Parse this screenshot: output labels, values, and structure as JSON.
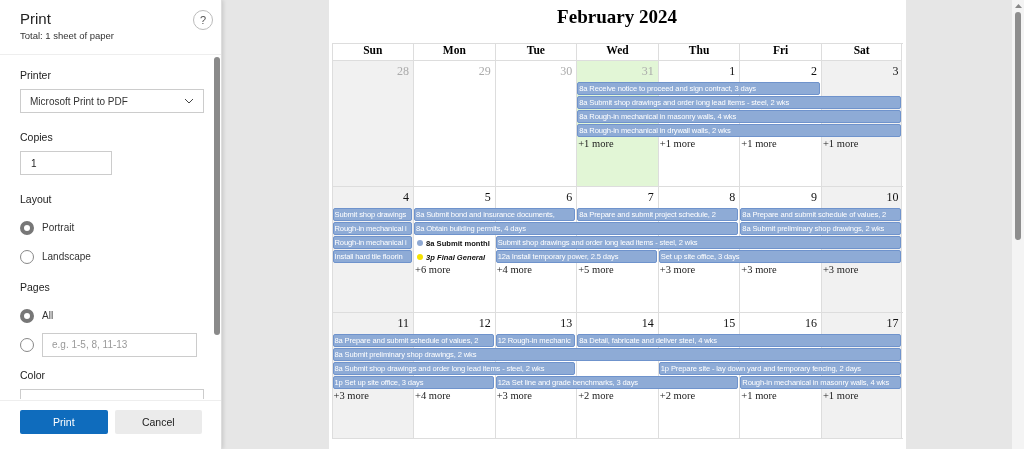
{
  "dialog": {
    "title": "Print",
    "subtitle": "Total: 1 sheet of paper",
    "help": "?",
    "printer": {
      "label": "Printer",
      "value": "Microsoft Print to PDF"
    },
    "copies": {
      "label": "Copies",
      "value": "1"
    },
    "layout": {
      "label": "Layout",
      "options": [
        {
          "label": "Portrait",
          "selected": true
        },
        {
          "label": "Landscape",
          "selected": false
        }
      ]
    },
    "pages": {
      "label": "Pages",
      "options": [
        {
          "kind": "label",
          "label": "All",
          "selected": true
        },
        {
          "kind": "range",
          "placeholder": "e.g. 1-5, 8, 11-13",
          "selected": false
        }
      ]
    },
    "color": {
      "label": "Color"
    },
    "buttons": [
      {
        "kind": "primary",
        "label": "Print"
      },
      {
        "kind": "secondary",
        "label": "Cancel"
      }
    ]
  },
  "calendar": {
    "title": "February 2024",
    "weekdays": [
      "Sun",
      "Mon",
      "Tue",
      "Wed",
      "Thu",
      "Fri",
      "Sat"
    ],
    "weeks": [
      {
        "days": [
          {
            "number": "28",
            "other_month": true,
            "highlighted": false
          },
          {
            "number": "29",
            "other_month": true,
            "highlighted": false
          },
          {
            "number": "30",
            "other_month": true,
            "highlighted": false
          },
          {
            "number": "31",
            "other_month": true,
            "highlighted": true,
            "more": "+1 more"
          },
          {
            "number": "1",
            "other_month": false,
            "highlighted": false,
            "more": "+1 more"
          },
          {
            "number": "2",
            "other_month": false,
            "highlighted": false,
            "more": "+1 more"
          },
          {
            "number": "3",
            "other_month": false,
            "highlighted": false,
            "more": "+1 more"
          }
        ],
        "lanes": [
          [
            {
              "kind": "empty"
            },
            {
              "kind": "empty"
            },
            {
              "kind": "empty"
            },
            {
              "kind": "bar",
              "text": "8a  Receive notice to proceed and sign contract, 3 days"
            },
            {
              "kind": "continued"
            },
            {
              "kind": "continued"
            },
            {
              "kind": "empty"
            }
          ],
          [
            {
              "kind": "empty"
            },
            {
              "kind": "empty"
            },
            {
              "kind": "empty"
            },
            {
              "kind": "bar",
              "text": "8a  Submit shop drawings and order long lead items - steel, 2 wks"
            },
            {
              "kind": "continued"
            },
            {
              "kind": "continued"
            },
            {
              "kind": "continued"
            }
          ],
          [
            {
              "kind": "empty"
            },
            {
              "kind": "empty"
            },
            {
              "kind": "empty"
            },
            {
              "kind": "bar",
              "text": "8a  Rough-in mechanical in masonry walls, 4 wks"
            },
            {
              "kind": "continued"
            },
            {
              "kind": "continued"
            },
            {
              "kind": "continued"
            }
          ],
          [
            {
              "kind": "empty"
            },
            {
              "kind": "empty"
            },
            {
              "kind": "empty"
            },
            {
              "kind": "bar",
              "text": "8a  Rough-in mechanical in drywall walls, 2 wks"
            },
            {
              "kind": "continued"
            },
            {
              "kind": "continued"
            },
            {
              "kind": "continued"
            }
          ]
        ]
      },
      {
        "days": [
          {
            "number": "4",
            "other_month": false,
            "highlighted": false
          },
          {
            "number": "5",
            "other_month": false,
            "highlighted": false,
            "more": "+6 more"
          },
          {
            "number": "6",
            "other_month": false,
            "highlighted": false,
            "more": "+4 more"
          },
          {
            "number": "7",
            "other_month": false,
            "highlighted": false,
            "more": "+5 more"
          },
          {
            "number": "8",
            "other_month": false,
            "highlighted": false,
            "more": "+3 more"
          },
          {
            "number": "9",
            "other_month": false,
            "highlighted": false,
            "more": "+3 more"
          },
          {
            "number": "10",
            "other_month": false,
            "highlighted": false,
            "more": "+3 more"
          }
        ],
        "lanes": [
          [
            {
              "kind": "bar",
              "text": "Submit shop drawings"
            },
            {
              "kind": "bar",
              "text": "8a Submit bond and insurance documents,"
            },
            {
              "kind": "continued"
            },
            {
              "kind": "bar",
              "text": "8a  Prepare and submit project schedule, 2"
            },
            {
              "kind": "continued"
            },
            {
              "kind": "bar",
              "text": "8a  Prepare and submit schedule of values, 2"
            },
            {
              "kind": "continued"
            }
          ],
          [
            {
              "kind": "bar",
              "text": "Rough-in mechanical i"
            },
            {
              "kind": "bar",
              "text": "8a  Obtain building permits, 4 days"
            },
            {
              "kind": "continued"
            },
            {
              "kind": "continued"
            },
            {
              "kind": "continued"
            },
            {
              "kind": "bar",
              "text": "8a  Submit preliminary shop drawings, 2 wks"
            },
            {
              "kind": "continued"
            }
          ],
          [
            {
              "kind": "bar",
              "text": "Rough-in mechanical i"
            },
            {
              "kind": "dot",
              "text": "8a Submit monthl",
              "color": "#8fa9d3",
              "italic": false
            },
            {
              "kind": "bar",
              "text": "Submit shop drawings and order long lead items - steel, 2 wks"
            },
            {
              "kind": "continued"
            },
            {
              "kind": "continued"
            },
            {
              "kind": "continued"
            },
            {
              "kind": "continued"
            }
          ],
          [
            {
              "kind": "bar",
              "text": "Install hard tile floorin"
            },
            {
              "kind": "dot",
              "text": "3p Final General",
              "color": "#f5e200",
              "italic": true
            },
            {
              "kind": "bar",
              "text": "12a  Install temporary power, 2.5 days"
            },
            {
              "kind": "continued"
            },
            {
              "kind": "bar",
              "text": "Set up site office, 3 days"
            },
            {
              "kind": "continued"
            },
            {
              "kind": "continued"
            }
          ]
        ]
      },
      {
        "days": [
          {
            "number": "11",
            "other_month": false,
            "highlighted": false,
            "more": "+3 more"
          },
          {
            "number": "12",
            "other_month": false,
            "highlighted": false,
            "more": "+4 more"
          },
          {
            "number": "13",
            "other_month": false,
            "highlighted": false,
            "more": "+3 more"
          },
          {
            "number": "14",
            "other_month": false,
            "highlighted": false,
            "more": "+2 more"
          },
          {
            "number": "15",
            "other_month": false,
            "highlighted": false,
            "more": "+2 more"
          },
          {
            "number": "16",
            "other_month": false,
            "highlighted": false,
            "more": "+1 more"
          },
          {
            "number": "17",
            "other_month": false,
            "highlighted": false,
            "more": "+1 more"
          }
        ],
        "lanes": [
          [
            {
              "kind": "bar",
              "text": "8a Prepare and submit schedule of values, 2"
            },
            {
              "kind": "continued"
            },
            {
              "kind": "bar",
              "text": "12 Rough-in mechanic"
            },
            {
              "kind": "bar",
              "text": "8a  Detail, fabricate and deliver steel, 4 wks"
            },
            {
              "kind": "continued"
            },
            {
              "kind": "continued"
            },
            {
              "kind": "continued"
            }
          ],
          [
            {
              "kind": "bar",
              "text": "8a  Submit preliminary shop drawings, 2 wks"
            },
            {
              "kind": "continued"
            },
            {
              "kind": "continued"
            },
            {
              "kind": "continued"
            },
            {
              "kind": "continued"
            },
            {
              "kind": "continued"
            },
            {
              "kind": "continued"
            }
          ],
          [
            {
              "kind": "bar",
              "text": "8a  Submit shop drawings and order long lead items - steel, 2 wks"
            },
            {
              "kind": "continued"
            },
            {
              "kind": "continued"
            },
            {
              "kind": "empty"
            },
            {
              "kind": "bar",
              "text": "1p  Prepare site - lay down yard and temporary fencing, 2 days"
            },
            {
              "kind": "continued"
            },
            {
              "kind": "continued"
            }
          ],
          [
            {
              "kind": "bar",
              "text": "1p  Set up site office, 3 days"
            },
            {
              "kind": "continued"
            },
            {
              "kind": "bar",
              "text": "12a  Set line and grade benchmarks, 3 days"
            },
            {
              "kind": "continued"
            },
            {
              "kind": "continued"
            },
            {
              "kind": "bar",
              "text": "Rough-in mechanical in masonry walls, 4 wks"
            },
            {
              "kind": "continued"
            }
          ]
        ]
      }
    ]
  }
}
